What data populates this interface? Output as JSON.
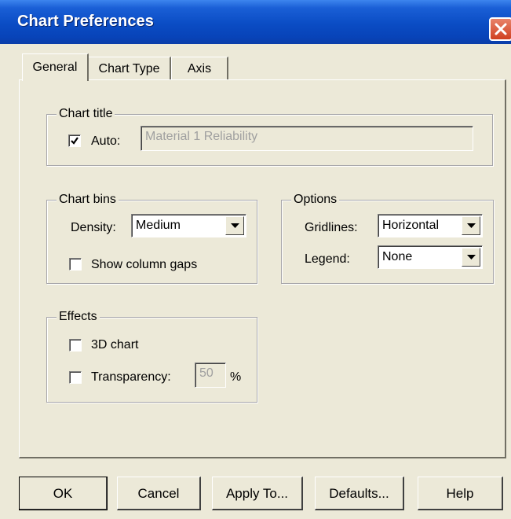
{
  "window": {
    "title": "Chart Preferences"
  },
  "tabs": [
    {
      "label": "General",
      "active": true
    },
    {
      "label": "Chart Type",
      "active": false
    },
    {
      "label": "Axis",
      "active": false
    }
  ],
  "chart_title": {
    "legend": "Chart title",
    "auto_label": "Auto:",
    "auto_checked": true,
    "title_value": "Material 1 Reliability"
  },
  "chart_bins": {
    "legend": "Chart bins",
    "density_label": "Density:",
    "density_value": "Medium",
    "column_gaps_label": "Show column gaps",
    "column_gaps_checked": false
  },
  "options": {
    "legend": "Options",
    "gridlines_label": "Gridlines:",
    "gridlines_value": "Horizontal",
    "legend_label": "Legend:",
    "legend_value": "None"
  },
  "effects": {
    "legend": "Effects",
    "chart3d_label": "3D chart",
    "chart3d_checked": false,
    "transparency_label": "Transparency:",
    "transparency_checked": false,
    "transparency_value": "50",
    "percent": "%"
  },
  "buttons": {
    "ok": "OK",
    "cancel": "Cancel",
    "apply_to": "Apply To...",
    "defaults": "Defaults...",
    "help": "Help"
  },
  "icons": {
    "close": "close-icon",
    "check": "check-icon",
    "dropdown": "chevron-down-icon"
  },
  "colors": {
    "titlebar": "#0a4cc4",
    "dialog_bg": "#ece9d8",
    "close_button": "#d04020"
  }
}
